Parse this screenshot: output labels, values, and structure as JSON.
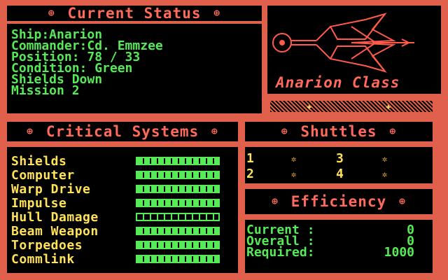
{
  "status": {
    "title": "Current Status",
    "lines": [
      "Ship:Anarion",
      "Commander:Cd. Emmzee",
      "Position: 78 / 33",
      "Condition: Green",
      "Shields Down",
      "Mission 2"
    ]
  },
  "ship": {
    "class_label": "Anarion Class"
  },
  "systems": {
    "title": "Critical Systems",
    "items": [
      {
        "label": "Shields",
        "level": 1.0
      },
      {
        "label": "Computer",
        "level": 1.0
      },
      {
        "label": "Warp Drive",
        "level": 1.0
      },
      {
        "label": "Impulse",
        "level": 1.0
      },
      {
        "label": "Hull Damage",
        "level": 0.0
      },
      {
        "label": "Beam Weapon",
        "level": 1.0
      },
      {
        "label": "Torpedoes",
        "level": 1.0
      },
      {
        "label": "Commlink",
        "level": 1.0
      }
    ]
  },
  "shuttles": {
    "title": "Shuttles",
    "items": [
      "1",
      "2",
      "3",
      "4"
    ]
  },
  "efficiency": {
    "title": "Efficiency",
    "rows": [
      {
        "label": "Current  :",
        "value": "0"
      },
      {
        "label": "Overall  :",
        "value": "0"
      },
      {
        "label": "Required:",
        "value": "1000"
      }
    ]
  },
  "colors": {
    "bg": "#e0604c",
    "text_green": "#56ea57",
    "text_yellow": "#ffe15a",
    "title_red": "#ff6a5a"
  },
  "icons": {
    "title_decoration": "diamond-dot-icon",
    "shuttle_indicator": "gear-dot-icon"
  }
}
